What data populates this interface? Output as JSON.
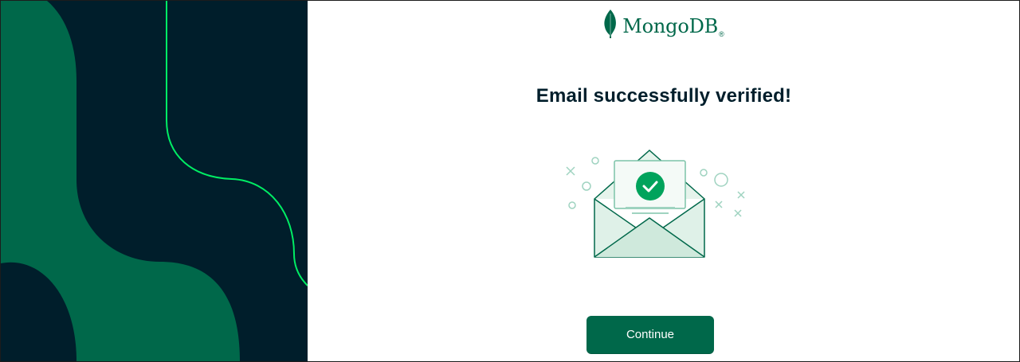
{
  "brand": {
    "name": "MongoDB",
    "mark": "®",
    "icon": "leaf-icon",
    "color": "#00684a"
  },
  "main": {
    "title": "Email successfully verified!",
    "illustration_icon": "envelope-check-icon",
    "continue_label": "Continue"
  },
  "colors": {
    "navy": "#001e2b",
    "forest": "#00684a",
    "accent_green": "#00ed64"
  }
}
